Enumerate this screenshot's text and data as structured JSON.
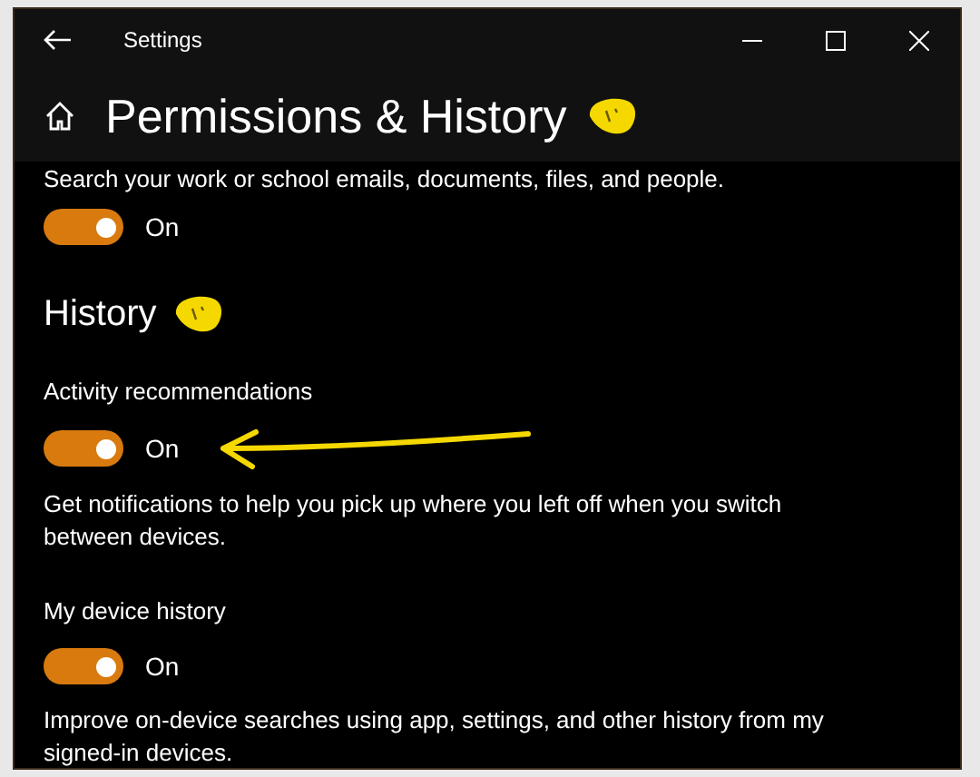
{
  "window": {
    "title": "Settings"
  },
  "page": {
    "title": "Permissions & History"
  },
  "intro": {
    "description": "Search your work or school emails, documents, files, and people.",
    "toggle": {
      "on": true,
      "label": "On"
    }
  },
  "section": {
    "title": "History"
  },
  "settings": [
    {
      "label": "Activity recommendations",
      "toggle": {
        "on": true,
        "label": "On"
      },
      "description": "Get notifications to help you pick up where you left off when you switch between devices."
    },
    {
      "label": "My device history",
      "toggle": {
        "on": true,
        "label": "On"
      },
      "description": "Improve on-device searches using app, settings, and other history from my signed-in devices."
    }
  ]
}
